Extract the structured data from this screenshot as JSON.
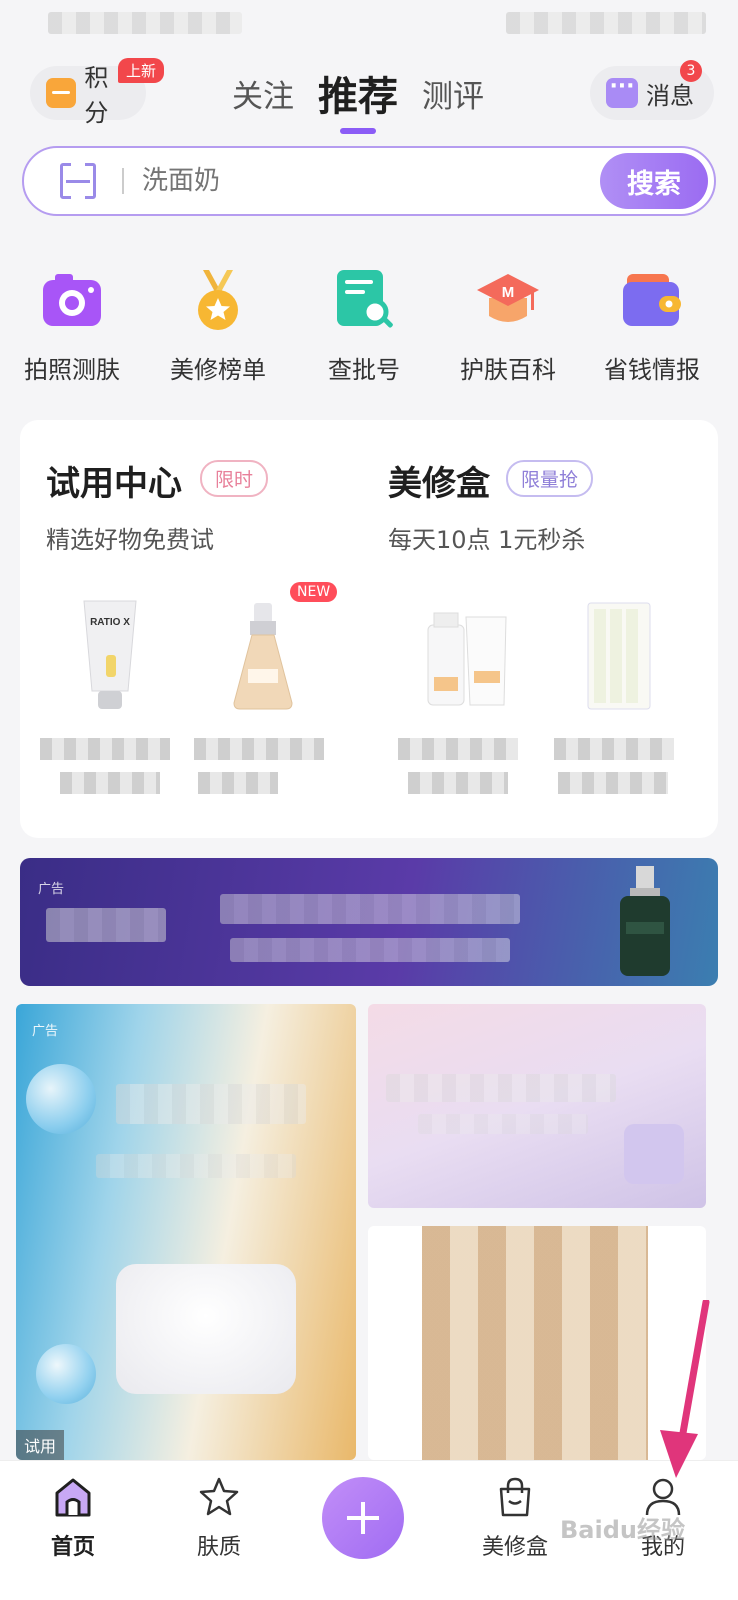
{
  "header": {
    "points": {
      "label": "积分",
      "badge": "上新"
    },
    "tabs": [
      {
        "label": "关注",
        "active": false
      },
      {
        "label": "推荐",
        "active": true
      },
      {
        "label": "测评",
        "active": false
      }
    ],
    "messages": {
      "label": "消息",
      "count": "3"
    }
  },
  "search": {
    "placeholder": "洗面奶",
    "button_label": "搜索"
  },
  "quick_entries": [
    {
      "label": "拍照测肤",
      "icon": "camera-icon"
    },
    {
      "label": "美修榜单",
      "icon": "medal-icon"
    },
    {
      "label": "查批号",
      "icon": "document-search-icon"
    },
    {
      "label": "护肤百科",
      "icon": "graduation-cap-icon"
    },
    {
      "label": "省钱情报",
      "icon": "wallet-icon"
    }
  ],
  "trial_center": {
    "title": "试用中心",
    "tag": "限时",
    "subtitle": "精选好物免费试",
    "new_badge": "NEW",
    "product_brand": "RATIO X"
  },
  "beauty_box": {
    "title": "美修盒",
    "tag": "限量抢",
    "subtitle": "每天10点 1元秒杀"
  },
  "feed": {
    "ad_label": "广告",
    "trial_label": "试用"
  },
  "bottom_nav": [
    {
      "label": "首页",
      "icon": "home-icon",
      "active": true
    },
    {
      "label": "肤质",
      "icon": "star-outline-icon",
      "active": false
    },
    {
      "label": "美修盒",
      "icon": "shopping-bag-icon",
      "active": false
    },
    {
      "label": "我的",
      "icon": "user-icon",
      "active": false
    }
  ],
  "watermark": "Baidu经验",
  "colors": {
    "accent": "#8b5cf6",
    "badge_red": "#f2474b",
    "trial_tag": "#e8809a",
    "box_tag": "#8f7fd8"
  }
}
